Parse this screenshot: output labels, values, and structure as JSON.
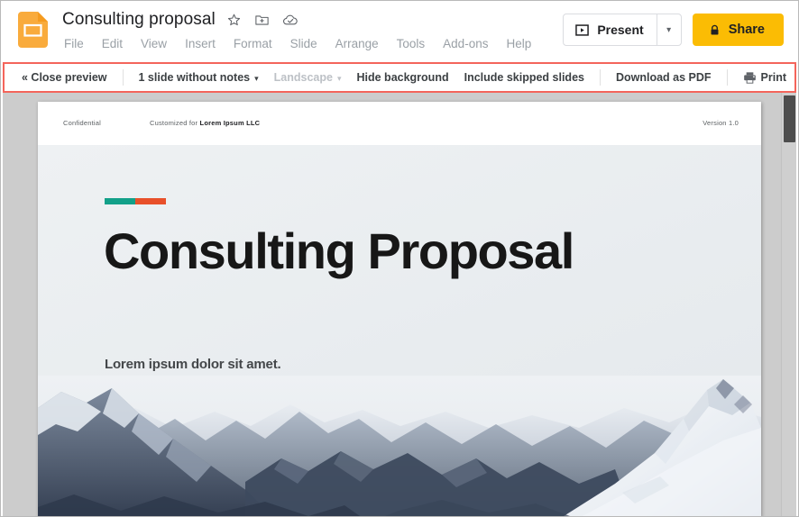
{
  "header": {
    "doc_icon": "google-slides-icon",
    "title": "Consulting proposal",
    "title_icons": [
      {
        "name": "star-icon",
        "glyph": "☆"
      },
      {
        "name": "move-to-folder-icon",
        "glyph": "folder-plus"
      },
      {
        "name": "cloud-saved-icon",
        "glyph": "cloud-check"
      }
    ],
    "menu": [
      "File",
      "Edit",
      "View",
      "Insert",
      "Format",
      "Slide",
      "Arrange",
      "Tools",
      "Add-ons",
      "Help"
    ],
    "present_label": "Present",
    "present_caret": "▾",
    "share_label": "Share",
    "share_color": "#fbbc04"
  },
  "preview_toolbar": {
    "highlight_color": "#f4655b",
    "close_preview": "« Close preview",
    "notes_option": "1 slide without notes",
    "notes_caret": "▾",
    "orientation_option": "Landscape",
    "orientation_caret": "▾",
    "hide_background": "Hide background",
    "include_skipped": "Include skipped slides",
    "download_pdf": "Download as PDF",
    "print_label": "Print",
    "print_icon": "printer-icon"
  },
  "slide": {
    "header": {
      "confidential": "Confidential",
      "customized_prefix": "Customized for ",
      "customized_company": "Lorem Ipsum LLC",
      "version": "Version 1.0"
    },
    "accent": {
      "teal": "#12a089",
      "orange": "#e8502a"
    },
    "title": "Consulting Proposal",
    "subtitle": "Lorem ipsum dolor sit amet.",
    "image_alt": "snow-covered-mountain-range-photo"
  },
  "scrollbar": {
    "orientation": "vertical",
    "thumb_position": "top"
  }
}
